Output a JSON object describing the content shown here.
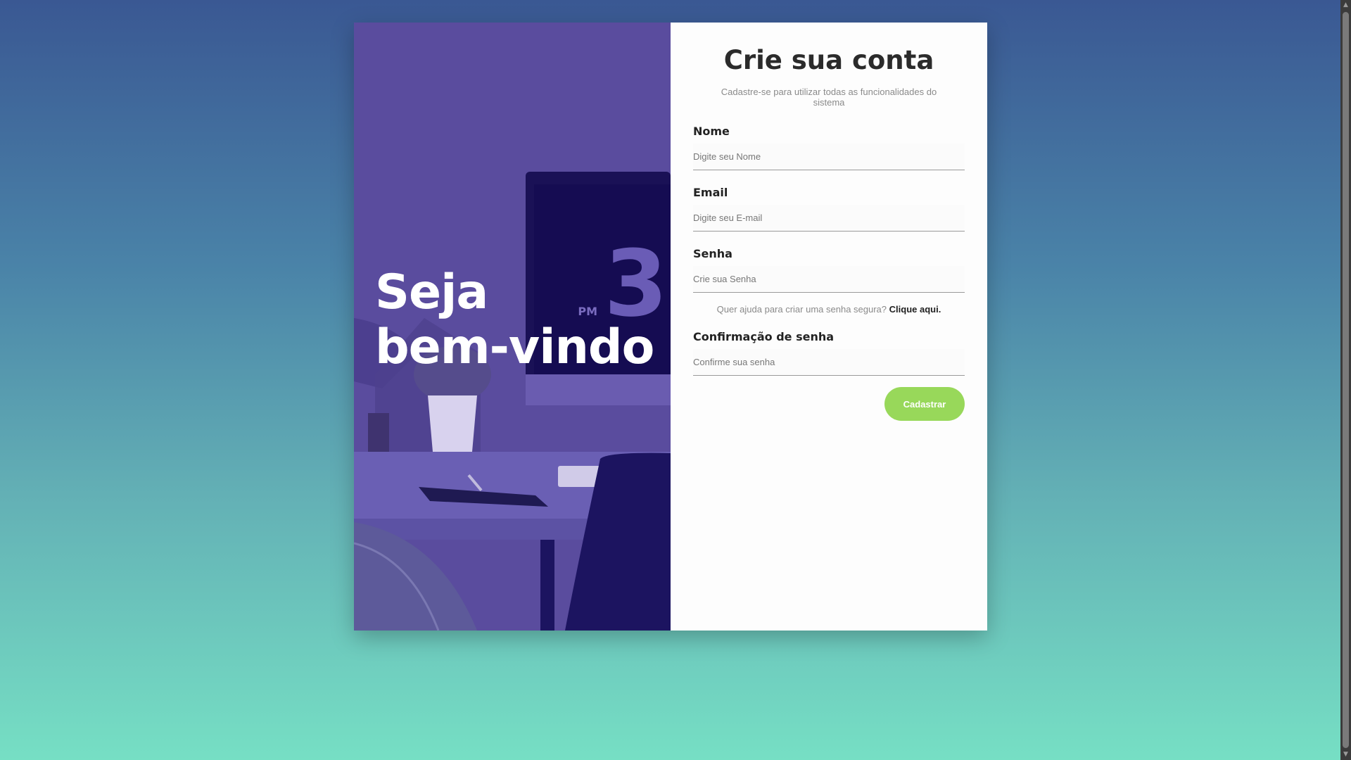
{
  "hero": {
    "title_line1": "Seja",
    "title_line2": "bem-vindo",
    "clock_digit": "3",
    "clock_suffix": "PM"
  },
  "form": {
    "title": "Crie sua conta",
    "subtitle": "Cadastre-se para utilizar todas as funcionalidades do sistema",
    "name": {
      "label": "Nome",
      "placeholder": "Digite seu Nome",
      "value": ""
    },
    "email": {
      "label": "Email",
      "placeholder": "Digite seu E-mail",
      "value": ""
    },
    "password": {
      "label": "Senha",
      "placeholder": "Crie sua Senha",
      "value": ""
    },
    "password_hint": "Quer ajuda para criar uma senha segura?",
    "password_hint_link": "Clique aqui.",
    "confirm": {
      "label": "Confirmação de senha",
      "placeholder": "Confirme sua senha",
      "value": ""
    },
    "submit_label": "Cadastrar"
  },
  "colors": {
    "hero_overlay": "#5a4c9e",
    "submit_button": "#98d85a",
    "background_top": "#3a5893",
    "background_bottom": "#76dfc4"
  }
}
